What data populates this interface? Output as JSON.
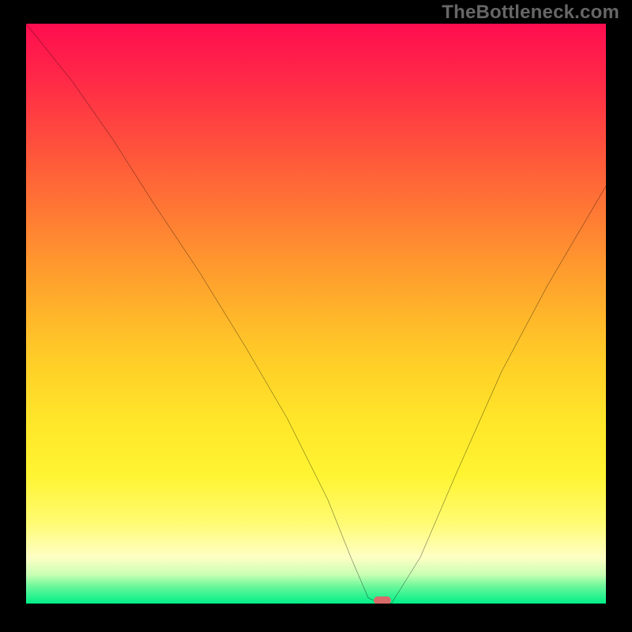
{
  "watermark": "TheBottleneck.com",
  "chart_data": {
    "type": "line",
    "title": "",
    "xlabel": "",
    "ylabel": "",
    "xlim": [
      0,
      100
    ],
    "ylim": [
      0,
      100
    ],
    "x": [
      0,
      8,
      15,
      22,
      30,
      38,
      45,
      52,
      56,
      59,
      61,
      63,
      68,
      74,
      82,
      90,
      100
    ],
    "values": [
      100,
      90,
      80,
      69,
      57,
      44,
      32,
      18,
      8,
      1,
      0,
      0,
      8,
      22,
      40,
      55,
      72
    ],
    "notch": {
      "x_start": 59,
      "x_end": 63,
      "y": 0
    },
    "marker": {
      "x": 61.5,
      "y": 0.5
    },
    "background_gradient_stops": [
      {
        "pos": 0,
        "color": "#ff0d4f"
      },
      {
        "pos": 26,
        "color": "#ff6238"
      },
      {
        "pos": 56,
        "color": "#ffc828"
      },
      {
        "pos": 78,
        "color": "#fff432"
      },
      {
        "pos": 92,
        "color": "#feffc4"
      },
      {
        "pos": 100,
        "color": "#00ef88"
      }
    ]
  },
  "marker_color": "#d96a6a",
  "curve_color": "#000000"
}
